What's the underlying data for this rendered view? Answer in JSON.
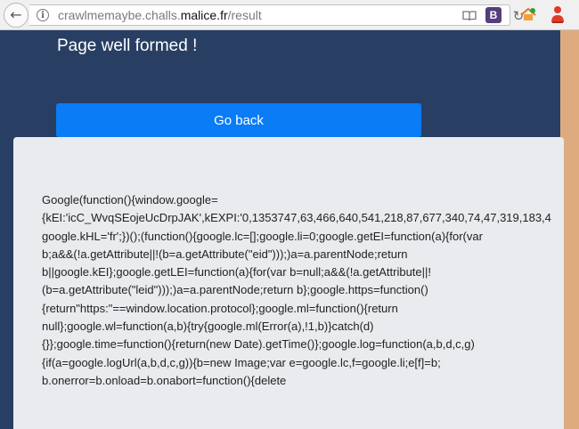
{
  "browser": {
    "url_prefix": "crawlmemaybe.challs.",
    "url_host": "malice.fr",
    "url_path": "/result",
    "bootstrap_badge": "B",
    "icons": [
      "back-arrow-icon",
      "info-icon",
      "reader-view-icon",
      "bootstrap-icon",
      "reload-icon",
      "extension-icon",
      "profile-icon"
    ]
  },
  "page": {
    "title": "Page well formed !",
    "go_back_label": "Go back"
  },
  "code": {
    "lines": [
      "Google(function(){window.google=",
      "{kEI:'icC_WvqSEojeUcDrpJAK',kEXPI:'0,1353747,63,466,640,541,218,87,677,340,74,47,319,183,4",
      "google.kHL='fr';})();(function(){google.lc=[];google.li=0;google.getEI=function(a){for(var",
      "b;a&&(!a.getAttribute||!(b=a.getAttribute(\"eid\")));)a=a.parentNode;return",
      "b||google.kEI};google.getLEI=function(a){for(var b=null;a&&(!a.getAttribute||!",
      "(b=a.getAttribute(\"leid\")));)a=a.parentNode;return b};google.https=function()",
      "{return\"https:\"==window.location.protocol};google.ml=function(){return",
      "null};google.wl=function(a,b){try{google.ml(Error(a),!1,b)}catch(d)",
      "{}};google.time=function(){return(new Date).getTime()};google.log=function(a,b,d,c,g)",
      "{if(a=google.logUrl(a,b,d,c,g)){b=new Image;var e=google.lc,f=google.li;e[f]=b;",
      "b.onerror=b.onload=b.onabort=function(){delete"
    ]
  },
  "colors": {
    "page_background": "#283f63",
    "button": "#0a7cf5",
    "card": "#e9ebee",
    "side_strip": "#deab7f"
  }
}
